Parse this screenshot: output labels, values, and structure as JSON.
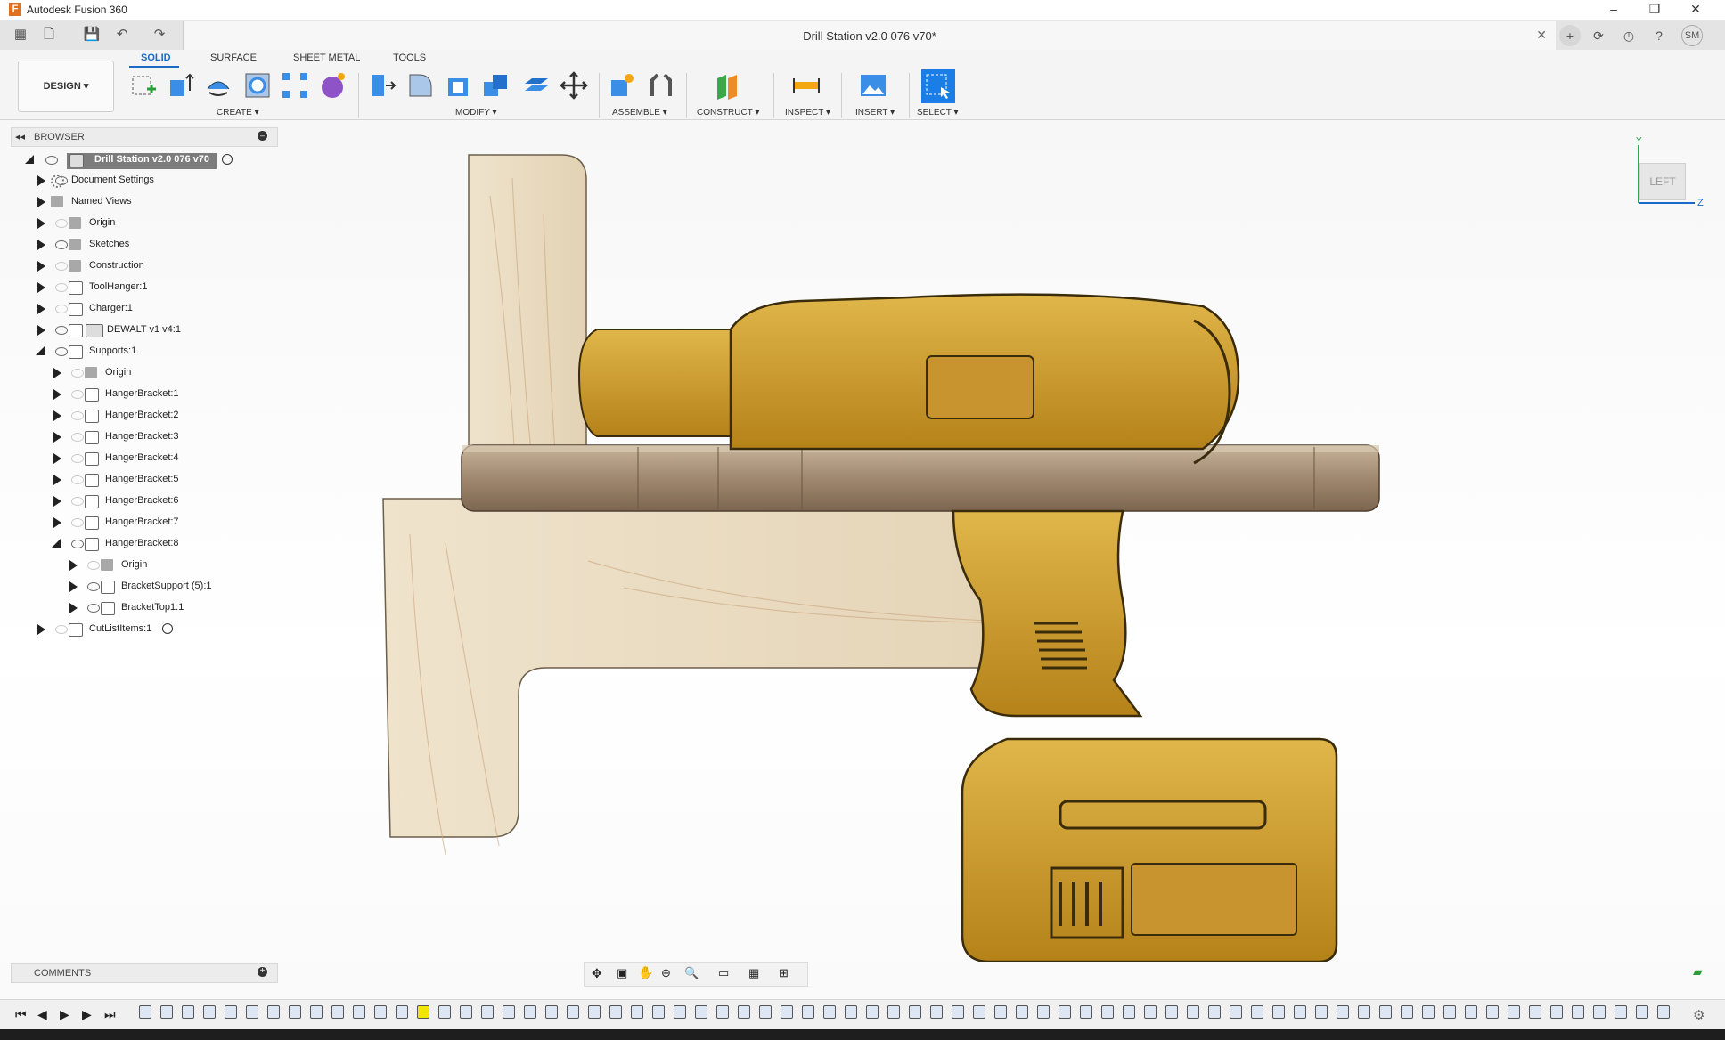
{
  "window": {
    "app_title": "Autodesk Fusion 360",
    "logo_letter": "F"
  },
  "document": {
    "tab_title": "Drill Station v2.0 076 v70*"
  },
  "user": {
    "initials": "SM"
  },
  "workspace": {
    "label": "DESIGN ▾"
  },
  "ribbon_tabs": [
    "SOLID",
    "SURFACE",
    "SHEET METAL",
    "TOOLS"
  ],
  "ribbon_groups": {
    "create": "CREATE ▾",
    "modify": "MODIFY ▾",
    "assemble": "ASSEMBLE ▾",
    "construct": "CONSTRUCT ▾",
    "inspect": "INSPECT ▾",
    "insert": "INSERT ▾",
    "select": "SELECT ▾"
  },
  "browser": {
    "title": "BROWSER",
    "root": "Drill Station v2.0 076 v70",
    "items": [
      {
        "label": "Document Settings",
        "icon": "gear-icon"
      },
      {
        "label": "Named Views",
        "icon": "folder-icon"
      },
      {
        "label": "Origin",
        "icon": "folder-icon"
      },
      {
        "label": "Sketches",
        "icon": "folder-icon"
      },
      {
        "label": "Construction",
        "icon": "folder-icon"
      },
      {
        "label": "ToolHanger:1",
        "icon": "component-icon"
      },
      {
        "label": "Charger:1",
        "icon": "component-icon"
      },
      {
        "label": "DEWALT v1 v4:1",
        "icon": "link-icon"
      },
      {
        "label": "Supports:1",
        "icon": "component-icon"
      },
      {
        "label": "Origin",
        "icon": "folder-icon"
      },
      {
        "label": "HangerBracket:1",
        "icon": "component-icon"
      },
      {
        "label": "HangerBracket:2",
        "icon": "component-icon"
      },
      {
        "label": "HangerBracket:3",
        "icon": "component-icon"
      },
      {
        "label": "HangerBracket:4",
        "icon": "component-icon"
      },
      {
        "label": "HangerBracket:5",
        "icon": "component-icon"
      },
      {
        "label": "HangerBracket:6",
        "icon": "component-icon"
      },
      {
        "label": "HangerBracket:7",
        "icon": "component-icon"
      },
      {
        "label": "HangerBracket:8",
        "icon": "component-icon"
      },
      {
        "label": "Origin",
        "icon": "folder-icon"
      },
      {
        "label": "BracketSupport (5):1",
        "icon": "component-icon"
      },
      {
        "label": "BracketTop1:1",
        "icon": "body-icon"
      },
      {
        "label": "CutListItems:1",
        "icon": "component-icon"
      }
    ]
  },
  "comments": {
    "title": "COMMENTS"
  },
  "viewcube": {
    "face": "LEFT",
    "axis_y": "Y",
    "axis_z": "Z"
  },
  "colors": {
    "accent": "#1b6ac9",
    "wood": "#e3d2b4",
    "drill": "#c9941f"
  }
}
